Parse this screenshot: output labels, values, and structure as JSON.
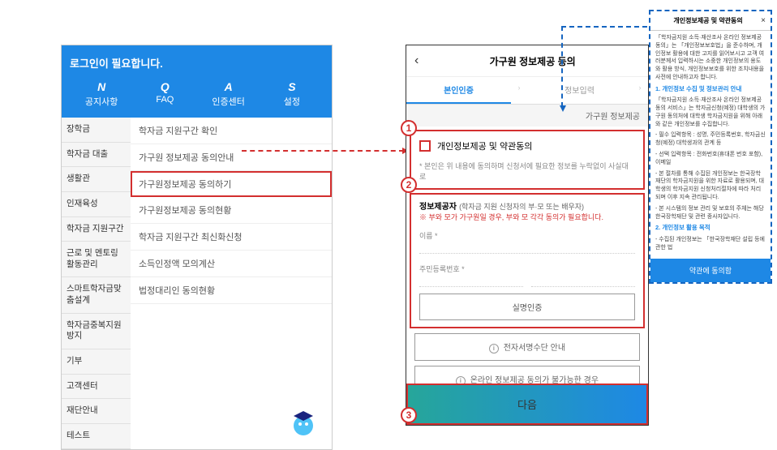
{
  "left": {
    "login_title": "로그인이 필요합니다.",
    "nav": [
      {
        "en": "N",
        "ko": "공지사항"
      },
      {
        "en": "Q",
        "ko": "FAQ"
      },
      {
        "en": "A",
        "ko": "인증센터"
      },
      {
        "en": "S",
        "ko": "설정"
      }
    ],
    "sidebar": [
      "장학금",
      "학자금 대출",
      "생활관",
      "인재육성",
      "학자금 지원구간",
      "근로 및 멘토링 활동관리",
      "스마트학자금맞춤설계",
      "학자금중복지원방지",
      "기부",
      "고객센터",
      "재단안내",
      "테스트"
    ],
    "content": [
      {
        "label": "학자금 지원구간 확인",
        "hl": false
      },
      {
        "label": "가구원 정보제공 동의안내",
        "hl": false
      },
      {
        "label": "가구원정보제공 동의하기",
        "hl": true
      },
      {
        "label": "가구원정보제공 동의현황",
        "hl": false
      },
      {
        "label": "학자금 지원구간 최신화신청",
        "hl": false
      },
      {
        "label": "소득인정액 모의계산",
        "hl": false
      },
      {
        "label": "법정대리인 동의현황",
        "hl": false
      }
    ]
  },
  "phone": {
    "title": "가구원 정보제공 동의",
    "tabs": {
      "t1": "본인인증",
      "t2": "정보입력"
    },
    "section_label": "가구원 정보제공",
    "consent_label": "개인정보제공 및 약관동의",
    "consent_note": "* 본인은 위 내용에 동의하며 신청서에 필요한 정보를 누락없이 사실대로",
    "provider_label": "정보제공자",
    "provider_sub": "(학자금 지원 신청자의 부·모 또는 배우자)",
    "provider_warn": "※ 부와 모가 가구원일 경우, 부와 모 각각 동의가 필요합니다.",
    "name_label": "이름 *",
    "rrn_label": "주민등록번호 *",
    "verify_btn": "실명인증",
    "info1": "전자서명수단 안내",
    "info2": "온라인 정보제공 동의가 불가능한 경우",
    "next_btn": "다음"
  },
  "popup": {
    "title": "개인정보제공 및 약관동의",
    "intro": "「학자금지원 소득·재산조사 온라인 정보제공 동의」는 「개인정보보호법」을 준수하며, 개인정보 활용에 대한 고지를 읽어보시고 고객 여러분께서 입력하시는 소중한 개인정보의 용도와 활용 방식, 개인정보보호를 위한 조치내용을 사전에 안내하고자 합니다.",
    "sec1_title": "1. 개인정보 수집 및 정보관리 안내",
    "sec1_body": "「학자금지원 소득·재산조사 온라인 정보제공 동의 서비스」는 학자금신청(예정) 대학생의 가구원 동의처에 대학생 학자금지원을 위해 아래와 같은 개인정보를 수집합니다.",
    "sec1_b1": "- 필수 입력항목 : 성명, 주민등록번호, 학자금신청(예정) 대학생과의 관계 등",
    "sec1_b2": "- 선택 입력항목 : 전화번호(휴대폰 번호 포함), 이메일",
    "sec1_b3": "- 본 절차를 통해 수집된 개인정보는 한국장학재단의 학자금지원을 위한 자료로 활용되며, 대학생의 학자금지원 신청처리절차에 따라 처리되며 이후 지속 관리됩니다.",
    "sec1_b4": "- 본 시스템의 정보 관리 및 보호의 주체는 해당 한국장학재단 및 관련 종사자입니다.",
    "sec2_title": "2. 개인정보 활용 목적",
    "sec2_body": "- 수집된 개인정보는 「한국장학재단 설립 등에 관한 법",
    "agree_btn": "약관에 동의함"
  },
  "callouts": {
    "c1": "1",
    "c2": "2",
    "c3": "3"
  }
}
